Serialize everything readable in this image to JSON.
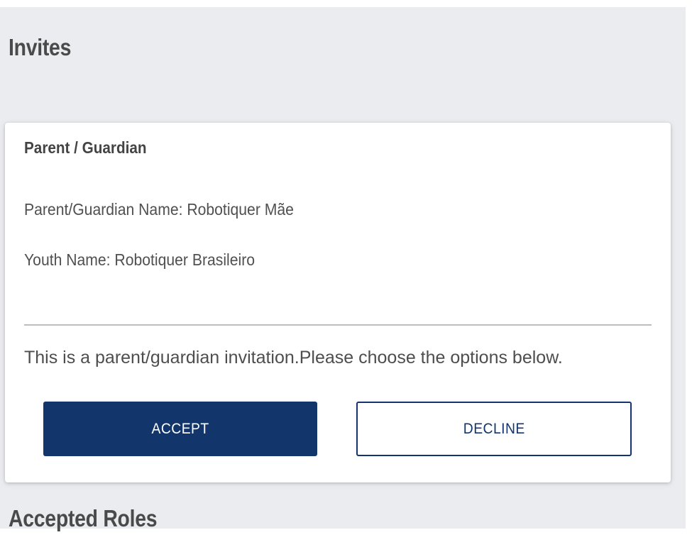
{
  "invites": {
    "title": "Invites",
    "card": {
      "header": "Parent / Guardian",
      "parent_name_line": "Parent/Guardian Name: Robotiquer Mãe",
      "youth_name_line": "Youth Name: Robotiquer Brasileiro",
      "message": "This is a parent/guardian invitation.Please choose the options below.",
      "accept_label": "ACCEPT",
      "decline_label": "DECLINE"
    }
  },
  "accepted_roles": {
    "title": "Accepted Roles"
  },
  "colors": {
    "page_background": "#ebecf0",
    "card_background": "#ffffff",
    "primary": "#12366b",
    "text": "#444444",
    "divider": "#bdbdbd"
  }
}
